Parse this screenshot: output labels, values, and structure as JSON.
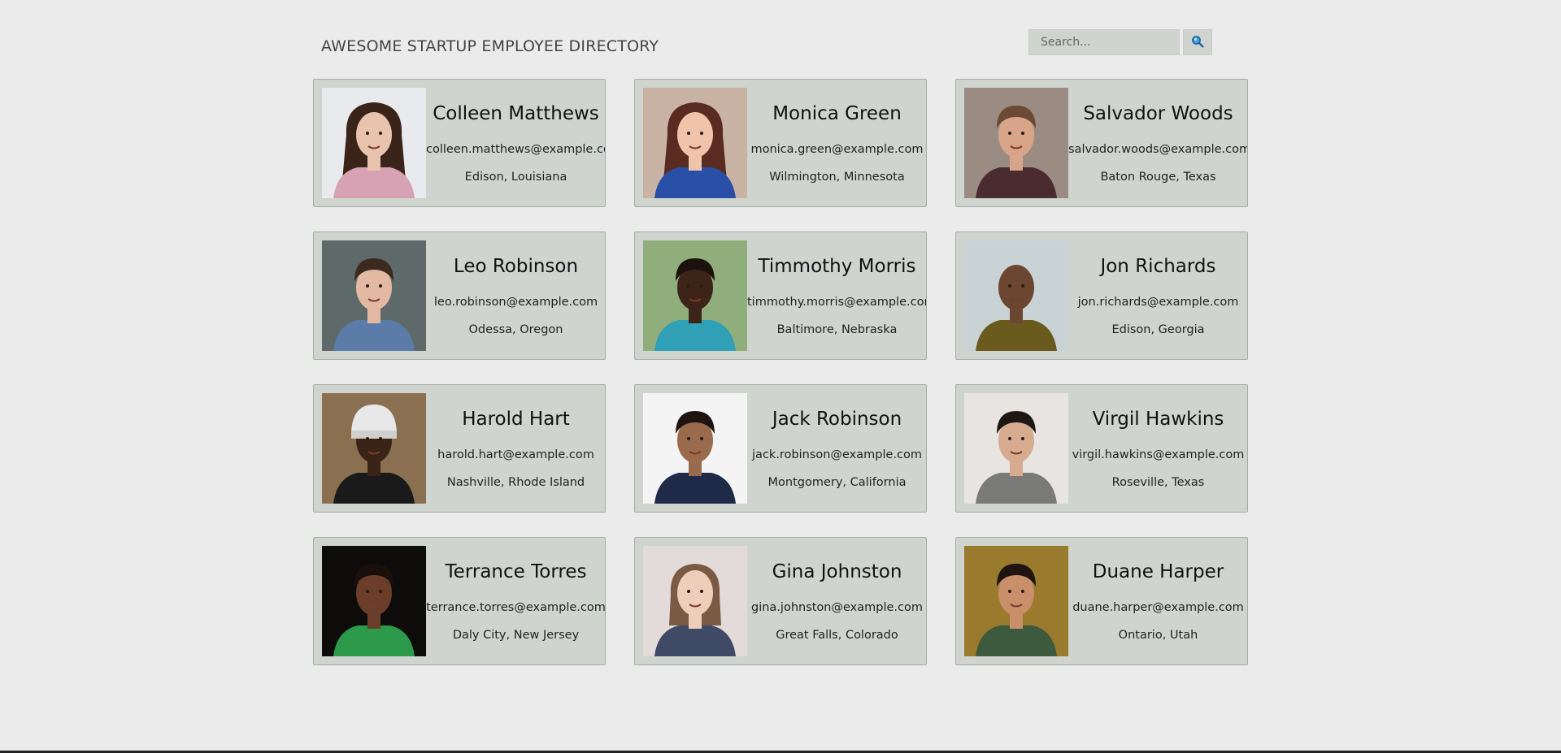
{
  "header": {
    "title": "AWESOME STARTUP EMPLOYEE DIRECTORY",
    "search_placeholder": "Search...",
    "search_value": "",
    "search_icon": "magnifier-icon"
  },
  "employees": [
    {
      "name": "Colleen Matthews",
      "email": "colleen.matthews@example.com",
      "location": "Edison, Louisiana",
      "photo": {
        "bg": "#e8eaee",
        "skin": "#e9c3ae",
        "hair": "#3a2318",
        "shirt": "#d7a2b4",
        "hair_style": "long"
      }
    },
    {
      "name": "Monica Green",
      "email": "monica.green@example.com",
      "location": "Wilmington, Minnesota",
      "photo": {
        "bg": "#c9b3a4",
        "skin": "#efc4aa",
        "hair": "#5a2b20",
        "shirt": "#2a4fa6",
        "hair_style": "long"
      }
    },
    {
      "name": "Salvador Woods",
      "email": "salvador.woods@example.com",
      "location": "Baton Rouge, Texas",
      "photo": {
        "bg": "#9a8c82",
        "skin": "#d9a58a",
        "hair": "#6b4a33",
        "shirt": "#4a2b2f",
        "hair_style": "short"
      }
    },
    {
      "name": "Leo Robinson",
      "email": "leo.robinson@example.com",
      "location": "Odessa, Oregon",
      "photo": {
        "bg": "#5e6a6a",
        "skin": "#e4b9a3",
        "hair": "#3b2a20",
        "shirt": "#5b7ca8",
        "hair_style": "short"
      }
    },
    {
      "name": "Timmothy Morris",
      "email": "timmothy.morris@example.com",
      "location": "Baltimore, Nebraska",
      "photo": {
        "bg": "#8fae7c",
        "skin": "#3c2418",
        "hair": "#1b120d",
        "shirt": "#2fa0b5",
        "hair_style": "short"
      }
    },
    {
      "name": "Jon Richards",
      "email": "jon.richards@example.com",
      "location": "Edison, Georgia",
      "photo": {
        "bg": "#c9d3d6",
        "skin": "#6b4631",
        "hair": "#4a2f20",
        "shirt": "#6b5a1e",
        "hair_style": "bald"
      }
    },
    {
      "name": "Harold Hart",
      "email": "harold.hart@example.com",
      "location": "Nashville, Rhode Island",
      "photo": {
        "bg": "#8a7050",
        "skin": "#3a2418",
        "hair": "#e8e8e8",
        "shirt": "#1a1a1a",
        "hair_style": "beanie"
      }
    },
    {
      "name": "Jack Robinson",
      "email": "jack.robinson@example.com",
      "location": "Montgomery, California",
      "photo": {
        "bg": "#f4f4f4",
        "skin": "#9a6a4c",
        "hair": "#1e1410",
        "shirt": "#1e2a48",
        "hair_style": "short"
      }
    },
    {
      "name": "Virgil Hawkins",
      "email": "virgil.hawkins@example.com",
      "location": "Roseville, Texas",
      "photo": {
        "bg": "#e7e4e2",
        "skin": "#d7ab90",
        "hair": "#1f1713",
        "shirt": "#7a7a78",
        "hair_style": "short"
      }
    },
    {
      "name": "Terrance Torres",
      "email": "terrance.torres@example.com",
      "location": "Daly City, New Jersey",
      "photo": {
        "bg": "#0e0c0b",
        "skin": "#6a3e28",
        "hair": "#1a100b",
        "shirt": "#2c9a4a",
        "hair_style": "short"
      }
    },
    {
      "name": "Gina Johnston",
      "email": "gina.johnston@example.com",
      "location": "Great Falls, Colorado",
      "photo": {
        "bg": "#e3dada",
        "skin": "#efcdbb",
        "hair": "#7a5a42",
        "shirt": "#3f4a66",
        "hair_style": "bob"
      }
    },
    {
      "name": "Duane Harper",
      "email": "duane.harper@example.com",
      "location": "Ontario, Utah",
      "photo": {
        "bg": "#9a7a2c",
        "skin": "#c98f6a",
        "hair": "#1e1410",
        "shirt": "#3d5a3e",
        "hair_style": "short"
      }
    }
  ]
}
